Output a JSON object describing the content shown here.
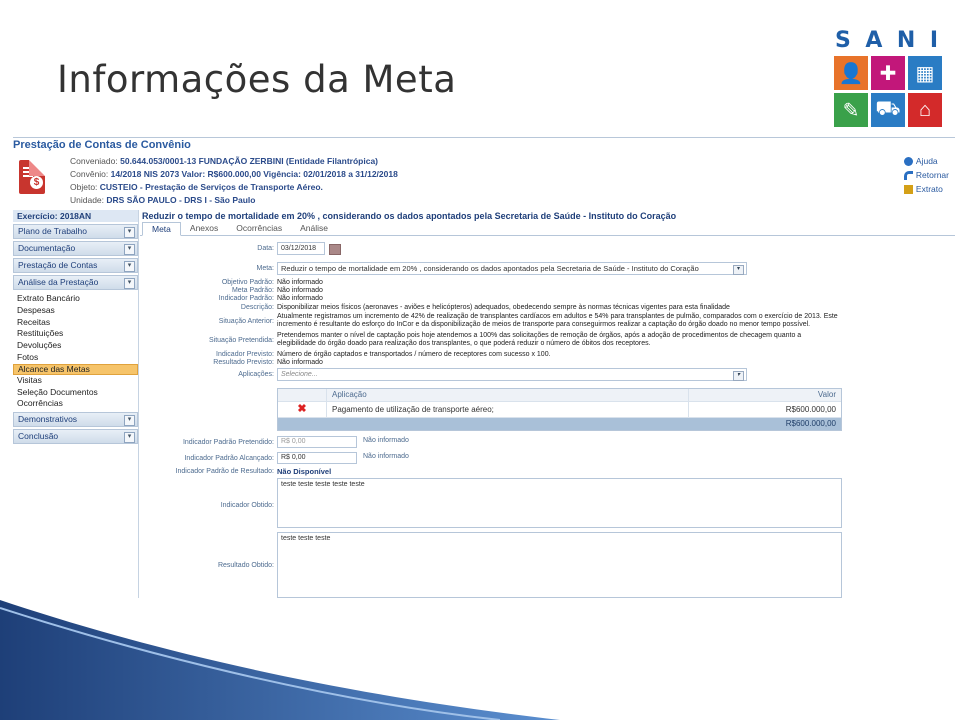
{
  "slide": {
    "title": "Informações da Meta"
  },
  "logo": {
    "word": [
      "S",
      "A",
      "N",
      "I"
    ],
    "word_colors": [
      "#1f5fa8",
      "#1f5fa8",
      "#1f5fa8",
      "#1f5fa8"
    ],
    "tiles": [
      {
        "icon": "user-icon",
        "color": "#e8732a",
        "glyph": "👤"
      },
      {
        "icon": "medkit-icon",
        "color": "#c2177a",
        "glyph": "✚"
      },
      {
        "icon": "building-icon",
        "color": "#2a7cc4",
        "glyph": "▦"
      },
      {
        "icon": "clipboard-icon",
        "color": "#3aa14a",
        "glyph": "✎"
      },
      {
        "icon": "ambulance-icon",
        "color": "#2a7cc4",
        "glyph": "⛟"
      },
      {
        "icon": "home-icon",
        "color": "#d32a2a",
        "glyph": "⌂"
      }
    ]
  },
  "app": {
    "title": "Prestação de Contas de Convênio",
    "header": {
      "conveniado_label": "Conveniado:",
      "conveniado_value": "50.644.053/0001-13  FUNDAÇÃO ZERBINI  (Entidade Filantrópica)",
      "convenio_label": "Convênio:",
      "convenio_value": "14/2018 NIS 2073 Valor: R$600.000,00 Vigência: 02/01/2018 a 31/12/2018",
      "objeto_label": "Objeto:",
      "objeto_value": "CUSTEIO - Prestação de Serviços de Transporte Aéreo.",
      "unidade_label": "Unidade:",
      "unidade_value": "DRS SÃO PAULO - DRS I - São Paulo"
    },
    "links": {
      "help": "Ajuda",
      "back": "Retornar",
      "extract": "Extrato"
    },
    "sidebar": {
      "exercise": "Exercício: 2018AN",
      "sections": [
        {
          "label": "Plano de Trabalho"
        },
        {
          "label": "Documentação"
        },
        {
          "label": "Prestação de Contas"
        },
        {
          "label": "Análise da Prestação"
        }
      ],
      "items": [
        "Extrato Bancário",
        "Despesas",
        "Receitas",
        "Restituições",
        "Devoluções",
        "Fotos",
        "Alcance das Metas",
        "Visitas",
        "Seleção Documentos",
        "Ocorrências"
      ],
      "bottom_sections": [
        {
          "label": "Demonstrativos"
        },
        {
          "label": "Conclusão"
        }
      ],
      "toggle_glyph": "▾"
    },
    "main": {
      "title": "Reduzir o tempo de mortalidade em 20% , considerando os dados apontados pela Secretaria de Saúde - Instituto do Coração",
      "tabs": [
        "Meta",
        "Anexos",
        "Ocorrências",
        "Análise"
      ],
      "form": {
        "data_label": "Data:",
        "data_value": "03/12/2018",
        "meta_label": "Meta:",
        "meta_value": "Reduzir o tempo de mortalidade em 20% , considerando os dados apontados pela Secretaria de Saúde - Instituto do Coração",
        "objetivo_label": "Objetivo Padrão:",
        "objetivo_value": "Não informado",
        "meta_padrao_label": "Meta Padrão:",
        "meta_padrao_value": "Não informado",
        "indicador_padrao_label": "Indicador Padrão:",
        "indicador_padrao_value": "Não informado",
        "descricao_label": "Descrição:",
        "descricao_value": "Disponibilizar meios físicos (aeronaves - aviões e helicópteros) adequados, obedecendo sempre às normas técnicas vigentes para esta finalidade",
        "situacao_anterior_label": "Situação Anterior:",
        "situacao_anterior_value": "Atualmente registramos um incremento de 42% de realização de transplantes cardíacos em adultos e 54% para transplantes de pulmão, comparados com o exercício de 2013. Este incremento é resultante do esforço do InCor e da disponibilização de meios de transporte para conseguirmos realizar a captação do órgão doado no menor tempo possível.",
        "situacao_pretendida_label": "Situação Pretendida:",
        "situacao_pretendida_value": "Pretendemos manter o nível de captação pois hoje atendemos a 100% das solicitações de remoção de órgãos, após a adoção de procedimentos de checagem quanto a elegibilidade do órgão doado para realização dos transplantes, o que poderá reduzir o número de óbitos dos receptores.",
        "indicador_previsto_label": "Indicador Previsto:",
        "indicador_previsto_value": "Número de órgão captados e transportados / número de receptores com sucesso x 100.",
        "resultado_previsto_label": "Resultado Previsto:",
        "resultado_previsto_value": "Não informado",
        "aplicacoes_label": "Aplicações:",
        "aplicacoes_placeholder": "Selecione...",
        "table": {
          "headers": [
            "Aplicação",
            "Valor"
          ],
          "rows": [
            {
              "aplicacao": "Pagamento de utilização de transporte aéreo;",
              "valor": "R$600.000,00"
            }
          ],
          "total": "R$600.000,00",
          "delete_glyph": "✖"
        },
        "ind_pretendido_label": "Indicador Padrão Pretendido:",
        "ind_pretendido_value": "R$ 0,00",
        "ind_pretendido_note": "Não informado",
        "ind_alcancado_label": "Indicador Padrão Alcançado:",
        "ind_alcancado_value": "R$ 0,00",
        "ind_alcancado_note": "Não informado",
        "ind_resultado_label": "Indicador Padrão de Resultado:",
        "ind_resultado_value": "Não Disponível",
        "indicador_obtido_label": "Indicador Obtido:",
        "indicador_obtido_value": "teste teste teste teste teste",
        "resultado_obtido_label": "Resultado Obtido:",
        "resultado_obtido_value": "teste teste teste"
      }
    }
  },
  "colors": {
    "swoosh_dark": "#1e3f78",
    "swoosh_light": "#5b8fd0",
    "accent": "#2a5aa0",
    "selected": "#f6c46a"
  }
}
